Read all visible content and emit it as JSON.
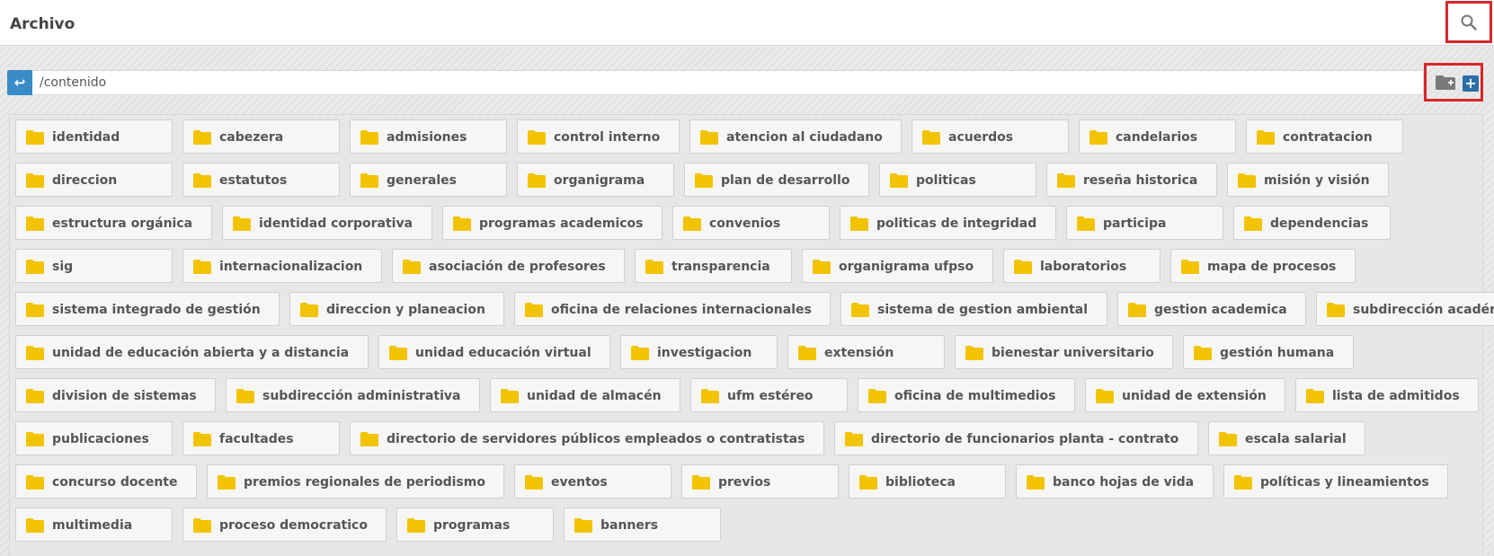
{
  "app": {
    "title": "Archivo"
  },
  "toolbar": {
    "back_label": "↩",
    "path": "/contenido",
    "upload_label": "+"
  },
  "icons": {
    "search": "search-icon",
    "back": "back-arrow-icon",
    "new_folder": "folder-plus-icon",
    "upload": "plus-icon",
    "folder": "folder-icon"
  },
  "colors": {
    "folder": "#f2c300",
    "accent_blue": "#3a8cc7",
    "highlight_red": "#d9262b"
  },
  "folders": [
    [
      "identidad",
      "cabezera",
      "admisiones",
      "control interno",
      "atencion al ciudadano",
      "acuerdos",
      "candelarios",
      "contratacion"
    ],
    [
      "direccion",
      "estatutos",
      "generales",
      "organigrama",
      "plan de desarrollo",
      "politicas",
      "reseña historica",
      "misión y visión"
    ],
    [
      "estructura orgánica",
      "identidad corporativa",
      "programas academicos",
      "convenios",
      "politicas de integridad",
      "participa",
      "dependencias"
    ],
    [
      "sig",
      "internacionalizacion",
      "asociación de profesores",
      "transparencia",
      "organigrama ufpso",
      "laboratorios",
      "mapa de procesos"
    ],
    [
      "sistema integrado de gestión",
      "direccion y planeacion",
      "oficina de relaciones internacionales",
      "sistema de gestion ambiental",
      "gestion academica",
      "subdirección académica"
    ],
    [
      "unidad de educación abierta y a distancia",
      "unidad educación virtual",
      "investigacion",
      "extensión",
      "bienestar universitario",
      "gestión humana"
    ],
    [
      "division de sistemas",
      "subdirección administrativa",
      "unidad de almacén",
      "ufm estéreo",
      "oficina de multimedios",
      "unidad de extensión",
      "lista de admitidos"
    ],
    [
      "publicaciones",
      "facultades",
      "directorio de servidores públicos empleados o contratistas",
      "directorio de funcionarios planta - contrato",
      "escala salarial"
    ],
    [
      "concurso docente",
      "premios regionales de periodismo",
      "eventos",
      "previos",
      "biblioteca",
      "banco hojas de vida",
      "políticas y lineamientos"
    ],
    [
      "multimedia",
      "proceso democratico",
      "programas",
      "banners"
    ]
  ]
}
